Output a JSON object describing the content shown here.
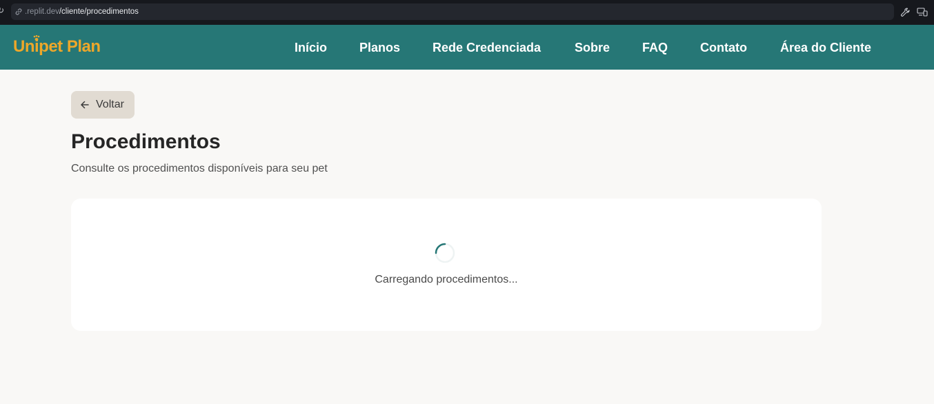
{
  "browser": {
    "url_host": ".replit.dev",
    "url_path": "/cliente/procedimentos",
    "icons": [
      "reload-icon",
      "link-icon",
      "wrench-icon",
      "devices-icon"
    ]
  },
  "header": {
    "logo_text": "Unipet Plan",
    "nav": [
      {
        "label": "Início"
      },
      {
        "label": "Planos"
      },
      {
        "label": "Rede Credenciada"
      },
      {
        "label": "Sobre"
      },
      {
        "label": "FAQ"
      },
      {
        "label": "Contato"
      },
      {
        "label": "Área do Cliente"
      }
    ]
  },
  "main": {
    "back_label": "Voltar",
    "title": "Procedimentos",
    "subtitle": "Consulte os procedimentos disponíveis para seu pet",
    "loading_text": "Carregando procedimentos..."
  },
  "colors": {
    "header_bg": "#267776",
    "logo": "#eda72a",
    "page_bg": "#f9f8f6",
    "back_button_bg": "#e1dbd2",
    "card_bg": "#ffffff"
  }
}
